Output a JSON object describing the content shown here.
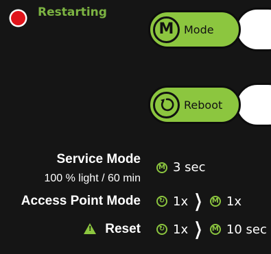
{
  "status": {
    "text": "Restarting",
    "dot_color": "#e0141b",
    "text_color": "#7cb342"
  },
  "buttons": {
    "mode": {
      "icon": "M",
      "label": "Mode"
    },
    "reboot": {
      "icon": "↻",
      "label": "Reboot"
    }
  },
  "legend": {
    "service_mode": {
      "label": "Service Mode",
      "sublabel": "100 % light / 60 min",
      "icon": "M",
      "value": "3 sec"
    },
    "access_point_mode": {
      "label": "Access Point Mode",
      "first_icon": "↻",
      "first_value": "1x",
      "second_icon": "M",
      "second_value": "1x"
    },
    "reset": {
      "label": "Reset",
      "first_icon": "↻",
      "first_value": "1x",
      "second_icon": "M",
      "second_value": "10 sec"
    }
  },
  "colors": {
    "background": "#151515",
    "accent_green": "#8cc63f"
  }
}
